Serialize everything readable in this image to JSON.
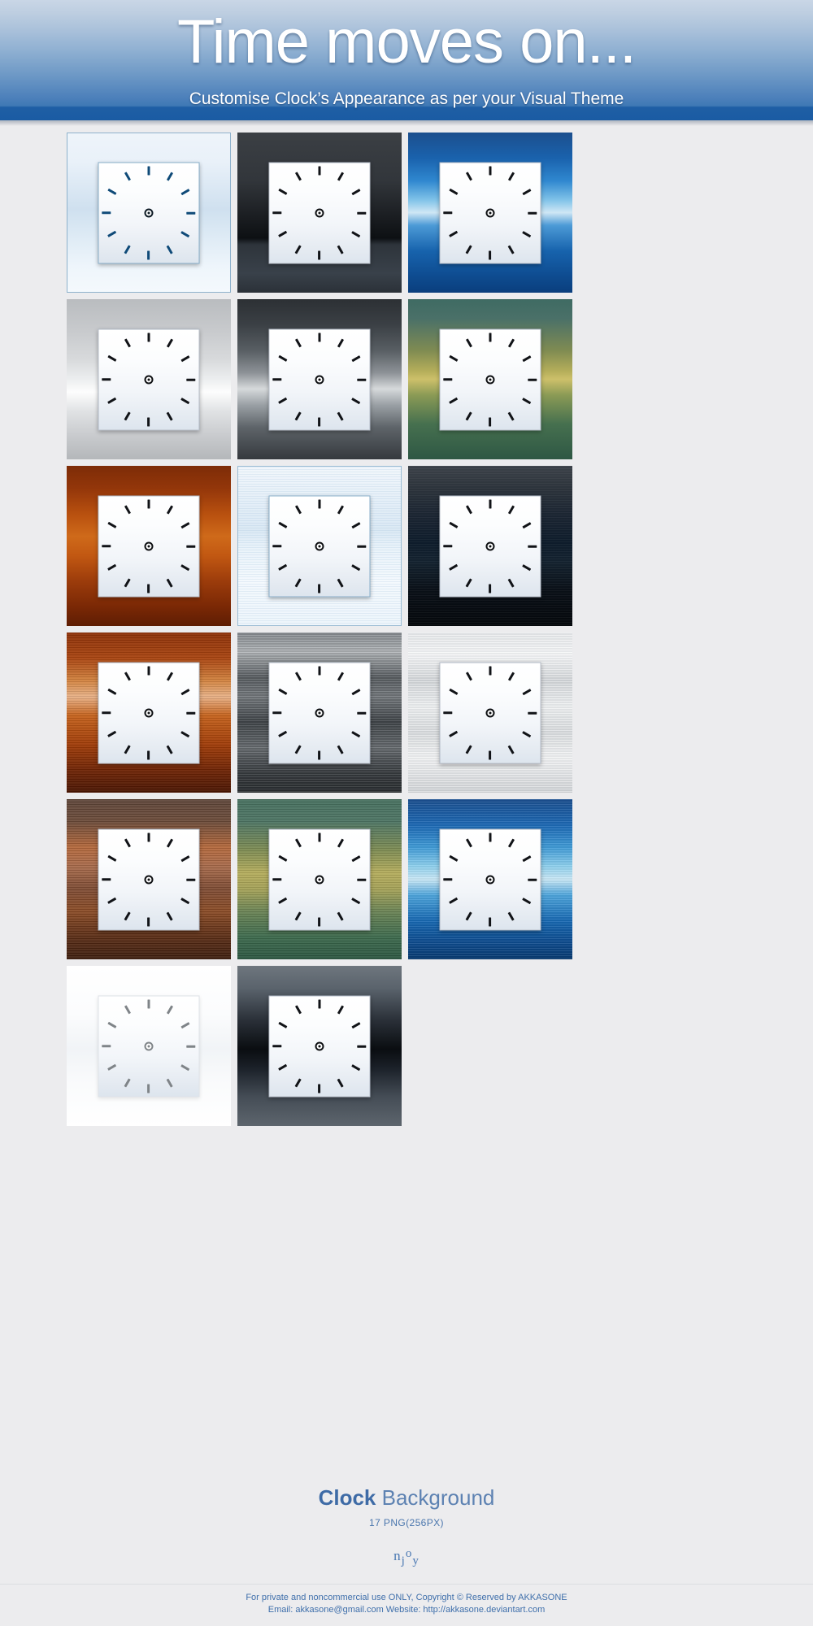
{
  "header": {
    "title": "Time moves on...",
    "subtitle": "Customise Clock’s Appearance as per your Visual Theme",
    "gradient_top": "#c9d6e6",
    "gradient_bottom": "#1a5ba3"
  },
  "gallery": {
    "rows": [
      [
        {
          "name": "clock-ice-frame",
          "style": "bg-iceframe",
          "ticks": "blue"
        },
        {
          "name": "clock-dark-gray",
          "style": "bg-darkgray",
          "ticks": "black"
        },
        {
          "name": "clock-blue-gloss",
          "style": "bg-blue1",
          "ticks": "black"
        }
      ],
      [
        {
          "name": "clock-silver",
          "style": "bg-silver",
          "ticks": "black"
        },
        {
          "name": "clock-gunmetal",
          "style": "bg-gunmetal",
          "ticks": "black"
        },
        {
          "name": "clock-olive-green",
          "style": "bg-olive",
          "ticks": "black"
        }
      ],
      [
        {
          "name": "clock-rust-orange",
          "style": "bg-rust",
          "ticks": "black"
        },
        {
          "name": "clock-pale-blue",
          "style": "bg-paleblue",
          "ticks": "black"
        },
        {
          "name": "clock-night-blue",
          "style": "bg-nightblue2",
          "ticks": "black"
        }
      ],
      [
        {
          "name": "clock-copper-stripe",
          "style": "bg-copper",
          "ticks": "black"
        },
        {
          "name": "clock-steel-stripe",
          "style": "bg-steelstripe",
          "ticks": "black"
        },
        {
          "name": "clock-white-steel",
          "style": "bg-whitesteel",
          "ticks": "black"
        }
      ],
      [
        {
          "name": "clock-wood-brown",
          "style": "bg-woodbrown",
          "ticks": "black"
        },
        {
          "name": "clock-green-olive",
          "style": "bg-greenolive",
          "ticks": "black"
        },
        {
          "name": "clock-sky-blue",
          "style": "bg-skyblue",
          "ticks": "black"
        }
      ],
      [
        {
          "name": "clock-white-frame",
          "style": "bg-whiteframe",
          "ticks": "gray"
        },
        {
          "name": "clock-slate-dark",
          "style": "bg-slatedark",
          "ticks": "black"
        }
      ]
    ],
    "tick_count": 12,
    "tick_color_black": "#111317",
    "tick_color_blue": "#0f4a78",
    "tick_color_gray": "#7f8488"
  },
  "caption": {
    "title_bold": "Clock",
    "title_rest": " Background",
    "subtitle": "17 PNG(256PX)",
    "njoy": {
      "n": "n",
      "j": "j",
      "o": "o",
      "y": "y"
    },
    "accent_color": "#3e6ba6"
  },
  "footer": {
    "line1": "For private and noncommercial use ONLY, Copyright © Reserved by AKKASONE",
    "line2": "Email: akkasone@gmail.com Website: http://akkasone.deviantart.com",
    "text_color": "#3f6fab"
  }
}
